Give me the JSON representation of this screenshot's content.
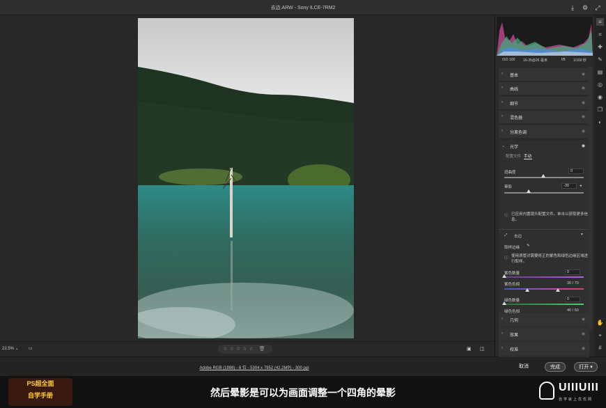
{
  "window": {
    "title": "去边.ARW -  Sony ILCE-7RM2"
  },
  "canvas": {
    "zoom": "22.5% ⌄",
    "stars": "☆☆☆☆☆ 🗑"
  },
  "camera": {
    "iso": "ISO 100",
    "lens": "16-35@26 毫米",
    "aperture": "f/8",
    "shutter": "1/160 秒"
  },
  "sections": [
    "基本",
    "曲线",
    "细节",
    "混色器",
    "分离色调",
    "几何",
    "效果",
    "校准"
  ],
  "optics": {
    "title": "光学",
    "tab_profile": "配置文件",
    "tab_manual": "手动",
    "distortion_label": "扭曲度",
    "distortion_value": "0",
    "vignette_label": "晕影",
    "vignette_value": "-39",
    "profile_info": "已应用内置镜头配置文件。单击以获取更多信息。",
    "defringe_title": "去边",
    "sample_label": "取样边缘",
    "defringe_info": "使用滴管对需要修正的紫色和绿色边缘区域进行取样。",
    "purple_amount_label": "紫色数量",
    "purple_amount_value": "0",
    "purple_hue_label": "紫色色相",
    "purple_hue_value": "30 / 70",
    "green_amount_label": "绿色数量",
    "green_amount_value": "0",
    "green_hue_label": "绿色色相",
    "green_hue_value": "40 / 60"
  },
  "footer": {
    "meta": "Adobe RGB (1998) - 8 位 - 5304 x 7952 (42.2MP) - 300 ppi",
    "cancel": "取消",
    "done": "完成",
    "open": "打开"
  },
  "overlay": {
    "subtitle": "然后晕影是可以为画面调整一个四角的晕影",
    "logo_line1": "PS超全面",
    "logo_line2": "自学手册",
    "brand": "UIIIUIII",
    "brand_tagline": "自学就上优优网"
  }
}
